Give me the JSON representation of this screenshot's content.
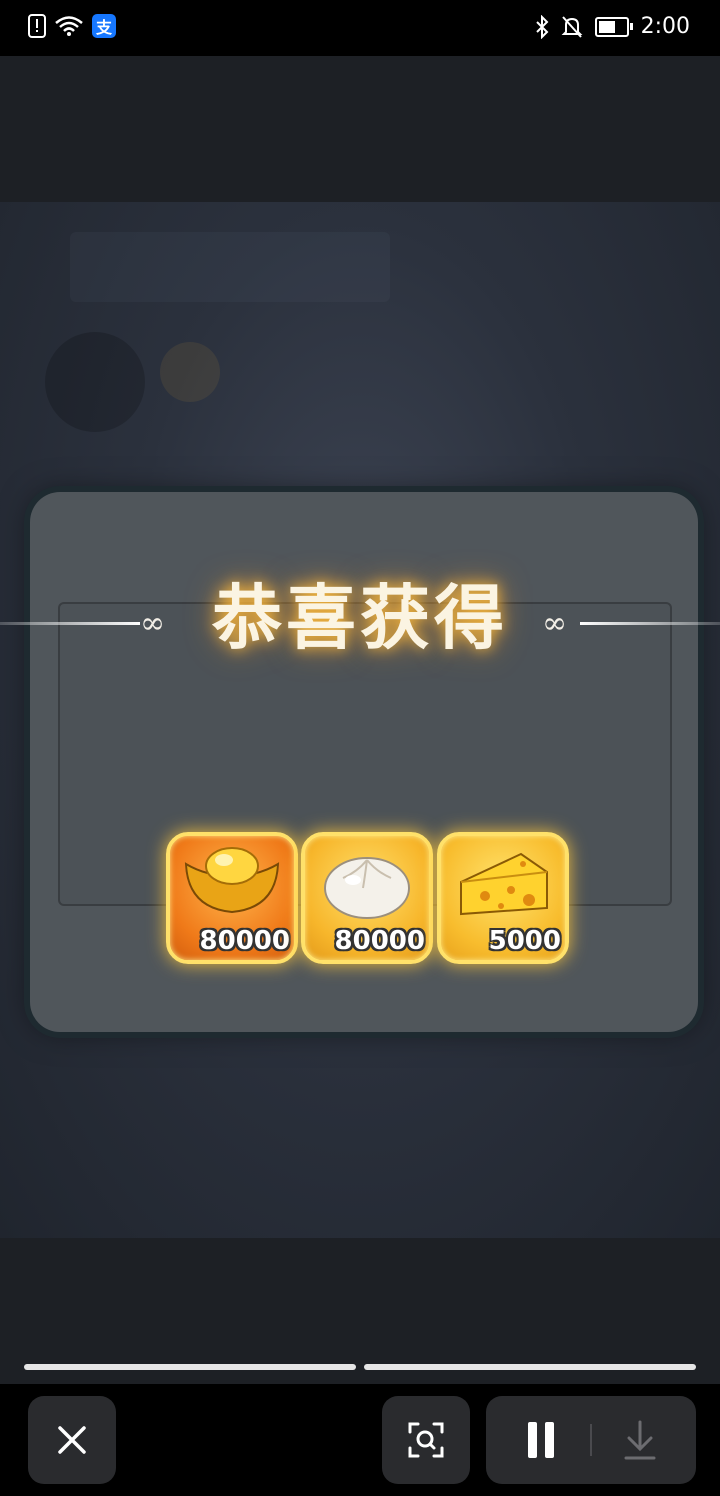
{
  "status_bar": {
    "time": "2:00",
    "alipay_glyph": "支",
    "icons": [
      "alert-icon",
      "wifi-icon",
      "alipay-icon",
      "bluetooth-icon",
      "mute-icon",
      "battery-icon"
    ]
  },
  "game": {
    "title": "恭喜获得",
    "ornament": "∞",
    "rewards": [
      {
        "name": "gold-ingot",
        "amount": "80000"
      },
      {
        "name": "steamed-bun",
        "amount": "80000"
      },
      {
        "name": "cheese",
        "amount": "5000"
      }
    ]
  },
  "player_controls": {
    "close_icon": "close-icon",
    "lens_icon": "lens-search-icon",
    "pause_icon": "pause-icon",
    "download_icon": "download-icon"
  }
}
